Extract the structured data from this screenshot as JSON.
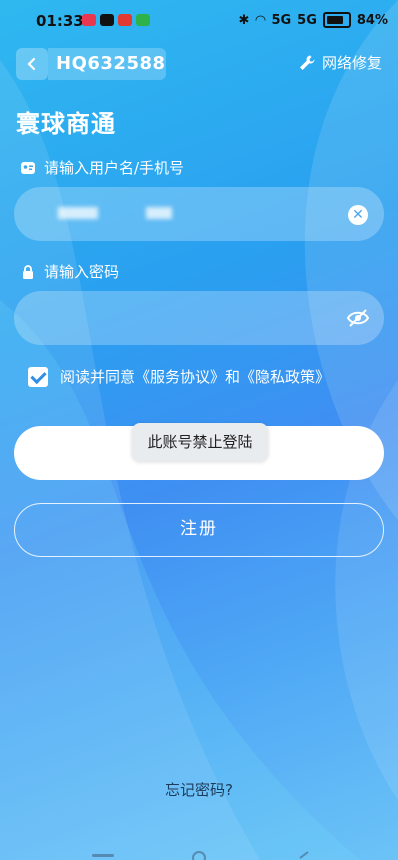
{
  "status_bar": {
    "time": "01:33",
    "battery": "84%",
    "signal_left": "5G",
    "signal_right": "5G"
  },
  "header": {
    "account_id": "HQ632588",
    "repair_label": "网络修复"
  },
  "app_title": "寰球商通",
  "form": {
    "username_label": "请输入用户名/手机号",
    "password_label": "请输入密码",
    "agreement_text": "阅读并同意《服务协议》和《隐私政策》",
    "agreement_checked": true
  },
  "buttons": {
    "login": "登录",
    "register": "注册",
    "forgot": "忘记密码?"
  },
  "toast": "此账号禁止登陆",
  "colors": {
    "bg_start": "#2fb8f0",
    "bg_mid": "#3f8ff2",
    "accent": "#2f8fe6"
  }
}
